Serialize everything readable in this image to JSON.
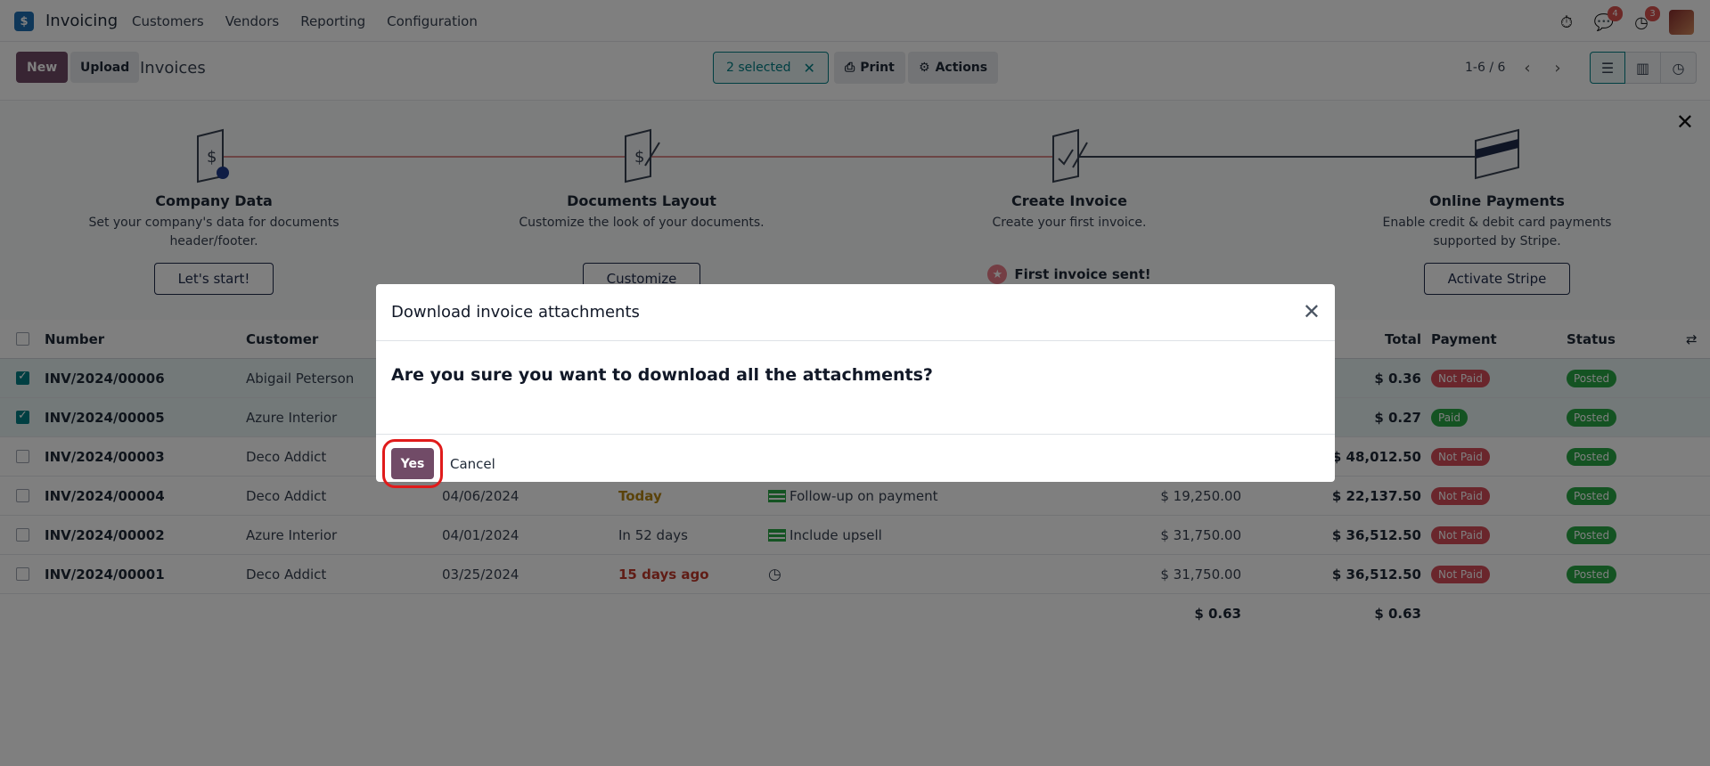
{
  "navbar": {
    "app_logo": "$",
    "app_name": "Invoicing",
    "menu": [
      "Customers",
      "Vendors",
      "Reporting",
      "Configuration"
    ],
    "messages_count": "4",
    "activities_count": "3"
  },
  "control_panel": {
    "new_label": "New",
    "upload_label": "Upload",
    "breadcrumb": "Invoices",
    "selected_label": "2 selected",
    "print_label": "Print",
    "actions_label": "Actions",
    "pager": "1-6 / 6"
  },
  "banner": {
    "steps": [
      {
        "title": "Company Data",
        "desc": "Set your company's data for documents header/footer.",
        "button": "Let's start!"
      },
      {
        "title": "Documents Layout",
        "desc": "Customize the look of your documents.",
        "button": "Customize"
      },
      {
        "title": "Create Invoice",
        "desc": "Create your first invoice.",
        "done": "First invoice sent!"
      },
      {
        "title": "Online Payments",
        "desc": "Enable credit & debit card payments supported by Stripe.",
        "button": "Activate Stripe"
      }
    ]
  },
  "table": {
    "headers": {
      "number": "Number",
      "customer": "Customer",
      "total": "Total",
      "payment": "Payment",
      "status": "Status"
    },
    "rows": [
      {
        "number": "INV/2024/00006",
        "customer": "Abigail Peterson",
        "date": "",
        "due": "",
        "activity": "",
        "untaxed": "",
        "total": "$ 0.36",
        "payment": "Not Paid",
        "status": "Posted"
      },
      {
        "number": "INV/2024/00005",
        "customer": "Azure Interior",
        "date": "",
        "due": "",
        "activity": "",
        "untaxed": "",
        "total": "$ 0.27",
        "payment": "Paid",
        "status": "Posted"
      },
      {
        "number": "INV/2024/00003",
        "customer": "Deco Addict",
        "date": "",
        "due": "",
        "activity": "",
        "untaxed": "",
        "total": "$ 48,012.50",
        "payment": "Not Paid",
        "status": "Posted"
      },
      {
        "number": "INV/2024/00004",
        "customer": "Deco Addict",
        "date": "04/06/2024",
        "due": "Today",
        "activity": "Follow-up on payment",
        "untaxed": "$ 19,250.00",
        "total": "$ 22,137.50",
        "payment": "Not Paid",
        "status": "Posted"
      },
      {
        "number": "INV/2024/00002",
        "customer": "Azure Interior",
        "date": "04/01/2024",
        "due": "In 52 days",
        "activity": "Include upsell",
        "untaxed": "$ 31,750.00",
        "total": "$ 36,512.50",
        "payment": "Not Paid",
        "status": "Posted"
      },
      {
        "number": "INV/2024/00001",
        "customer": "Deco Addict",
        "date": "03/25/2024",
        "due": "15 days ago",
        "activity": "",
        "untaxed": "$ 31,750.00",
        "total": "$ 36,512.50",
        "payment": "Not Paid",
        "status": "Posted"
      }
    ],
    "totals": {
      "untaxed": "$ 0.63",
      "total": "$ 0.63"
    }
  },
  "modal": {
    "title": "Download invoice attachments",
    "question": "Are you sure you want to download all the attachments?",
    "yes_label": "Yes",
    "cancel_label": "Cancel"
  },
  "colors": {
    "brand": "#714b67",
    "accent": "#017e84",
    "danger": "#d44c59",
    "success": "#28a745"
  }
}
